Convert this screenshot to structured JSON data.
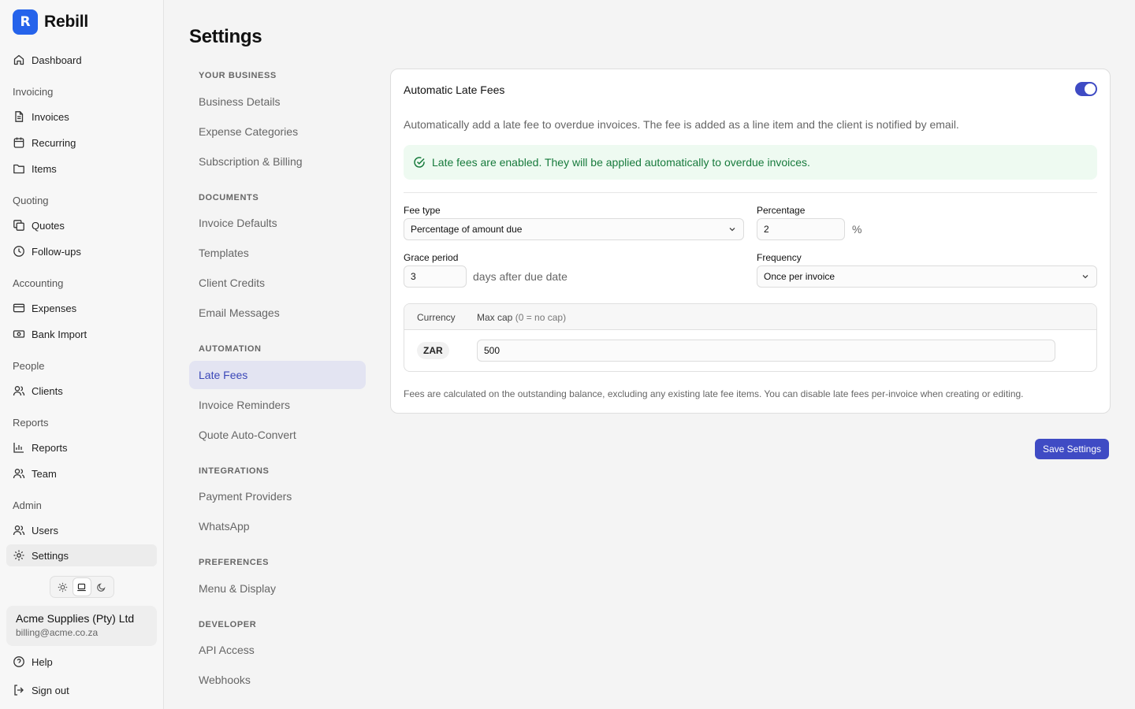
{
  "brand": {
    "logo_letter": "R",
    "name": "Rebill",
    "accent": "#2563eb"
  },
  "sidebar": {
    "dashboard": "Dashboard",
    "groups": {
      "invoicing": "Invoicing",
      "quoting": "Quoting",
      "accounting": "Accounting",
      "people": "People",
      "reports": "Reports",
      "admin": "Admin"
    },
    "items": {
      "invoices": "Invoices",
      "recurring": "Recurring",
      "items": "Items",
      "quotes": "Quotes",
      "followups": "Follow-ups",
      "expenses": "Expenses",
      "bank_import": "Bank Import",
      "clients": "Clients",
      "reports": "Reports",
      "team": "Team",
      "users": "Users",
      "settings": "Settings"
    },
    "active_item": "Settings",
    "theme_options": [
      "sun-icon",
      "laptop-icon",
      "moon-icon"
    ],
    "theme_active": "laptop-icon",
    "account": {
      "name": "Acme Supplies (Pty) Ltd",
      "email": "billing@acme.co.za"
    },
    "help": "Help",
    "sign_out": "Sign out"
  },
  "page": {
    "title": "Settings"
  },
  "settings_nav": {
    "your_business": {
      "header": "YOUR BUSINESS",
      "items": [
        "Business Details",
        "Expense Categories",
        "Subscription & Billing"
      ]
    },
    "documents": {
      "header": "DOCUMENTS",
      "items": [
        "Invoice Defaults",
        "Templates",
        "Client Credits",
        "Email Messages"
      ]
    },
    "automation": {
      "header": "AUTOMATION",
      "items": [
        "Late Fees",
        "Invoice Reminders",
        "Quote Auto-Convert"
      ]
    },
    "integrations": {
      "header": "INTEGRATIONS",
      "items": [
        "Payment Providers",
        "WhatsApp"
      ]
    },
    "preferences": {
      "header": "PREFERENCES",
      "items": [
        "Menu & Display"
      ]
    },
    "developer": {
      "header": "DEVELOPER",
      "items": [
        "API Access",
        "Webhooks"
      ]
    },
    "active_item": "Late Fees"
  },
  "late_fees": {
    "title": "Automatic Late Fees",
    "enabled": true,
    "description": "Automatically add a late fee to overdue invoices. The fee is added as a line item and the client is notified by email.",
    "notice": "Late fees are enabled. They will be applied automatically to overdue invoices.",
    "fee_type": {
      "label": "Fee type",
      "value": "Percentage of amount due"
    },
    "percentage": {
      "label": "Percentage",
      "value": "2",
      "suffix": "%"
    },
    "grace_period": {
      "label": "Grace period",
      "value": "3",
      "suffix": "days after due date"
    },
    "frequency": {
      "label": "Frequency",
      "value": "Once per invoice"
    },
    "cap_table": {
      "col_currency": "Currency",
      "col_max_cap": "Max cap",
      "col_max_cap_hint": "(0 = no cap)",
      "rows": [
        {
          "currency": "ZAR",
          "max_cap": "500"
        }
      ]
    },
    "footnote": "Fees are calculated on the outstanding balance, excluding any existing late fee items. You can disable late fees per-invoice when creating or editing."
  },
  "actions": {
    "save": "Save Settings"
  },
  "colors": {
    "primary": "#3f4bc4",
    "success_bg": "#eefaf1",
    "success_text": "#177a3c"
  }
}
